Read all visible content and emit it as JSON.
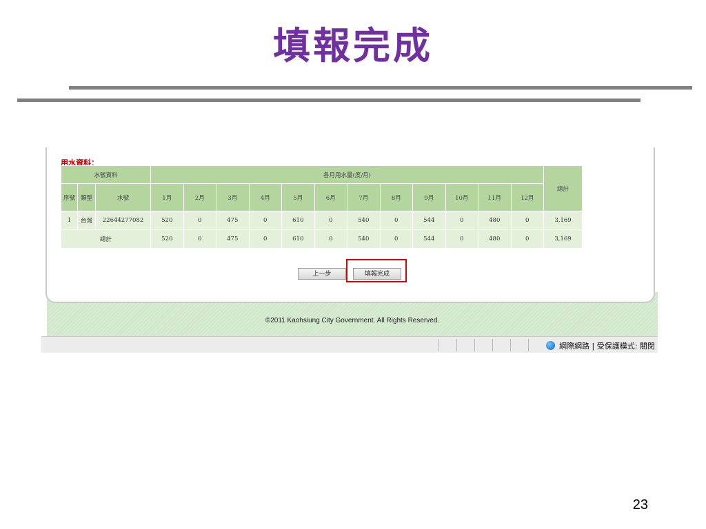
{
  "slide": {
    "title": "填報完成",
    "page_number": "23"
  },
  "section_label": "用水資料：",
  "table": {
    "group_headers": {
      "meter_info": "水號資料",
      "monthly_usage": "各月用水量(度/月)",
      "total": "總計"
    },
    "sub_headers": {
      "serial": "序號",
      "category": "類型",
      "meter_no": "水號",
      "months": [
        "1月",
        "2月",
        "3月",
        "4月",
        "5月",
        "6月",
        "7月",
        "8月",
        "9月",
        "10月",
        "11月",
        "12月"
      ]
    },
    "rows": [
      {
        "serial": "1",
        "category": "台灣",
        "meter_no": "22644277082",
        "months": [
          "520",
          "0",
          "475",
          "0",
          "610",
          "0",
          "540",
          "0",
          "544",
          "0",
          "480",
          "0"
        ],
        "total": "3,169"
      }
    ],
    "total_row": {
      "label": "總計",
      "months": [
        "520",
        "0",
        "475",
        "0",
        "610",
        "0",
        "540",
        "0",
        "544",
        "0",
        "480",
        "0"
      ],
      "total": "3,169"
    }
  },
  "buttons": {
    "prev": "上一步",
    "done": "填報完成"
  },
  "footer": {
    "copyright": "©2011 Kaohsiung City Government. All Rights Reserved."
  },
  "statusbar": {
    "zone": "網際網路 | 受保護模式: 關閉"
  },
  "colors": {
    "title": "#7030a0",
    "header_green": "#b5d59f",
    "cell_green": "#e4f0d9",
    "highlight": "#e00000",
    "label_red": "#cc0000"
  }
}
